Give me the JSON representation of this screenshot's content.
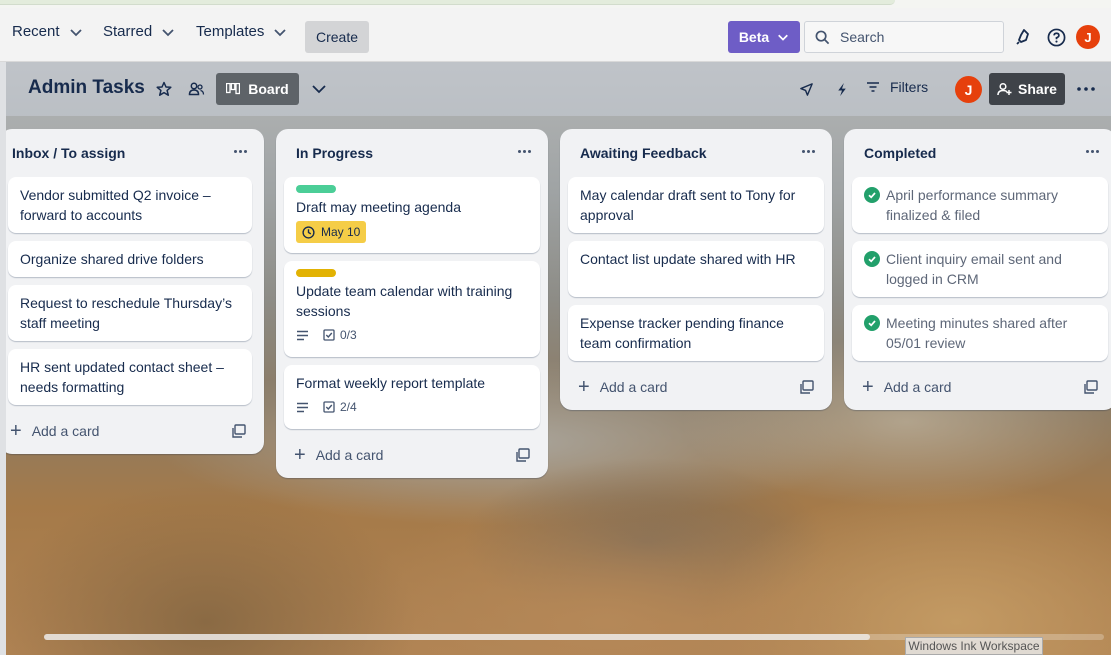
{
  "nav": {
    "recent": "Recent",
    "starred": "Starred",
    "templates": "Templates",
    "create": "Create",
    "beta": "Beta",
    "search_placeholder": "Search",
    "avatar_initial": "J"
  },
  "board": {
    "title": "Admin Tasks",
    "view_label": "Board",
    "filters_label": "Filters",
    "share_label": "Share",
    "member_initial": "J"
  },
  "lists": [
    {
      "title": "Inbox / To assign",
      "cards": [
        {
          "text": "Vendor submitted Q2 invoice – forward to accounts"
        },
        {
          "text": "Organize shared drive folders"
        },
        {
          "text": "Request to reschedule Thursday’s staff meeting"
        },
        {
          "text": "HR sent updated contact sheet – needs formatting"
        }
      ],
      "add_label": "Add a card"
    },
    {
      "title": "In Progress",
      "cards": [
        {
          "text": "Draft may meeting agenda",
          "label_color": "#4bce97",
          "due": "May 10"
        },
        {
          "text": "Update team calendar with training sessions",
          "label_color": "#e2b203",
          "checklist": "0/3"
        },
        {
          "text": "Format weekly report template",
          "checklist": "2/4"
        }
      ],
      "add_label": "Add a card"
    },
    {
      "title": "Awaiting Feedback",
      "cards": [
        {
          "text": "May calendar draft sent to Tony for approval"
        },
        {
          "text": "Contact list update shared with HR"
        },
        {
          "text": "Expense tracker pending finance team confirmation"
        }
      ],
      "add_label": "Add a card"
    },
    {
      "title": "Completed",
      "cards": [
        {
          "text": "April performance summary finalized & filed"
        },
        {
          "text": "Client inquiry email sent and logged in CRM"
        },
        {
          "text": "Meeting minutes shared after 05/01 review"
        }
      ],
      "add_label": "Add a card"
    }
  ],
  "taskbar_hint": "Windows Ink Workspace",
  "colors": {
    "beta": "#6e5dc6",
    "due_badge": "#f5cd47",
    "done_check": "#22a06b",
    "avatar": "#e6400c"
  }
}
